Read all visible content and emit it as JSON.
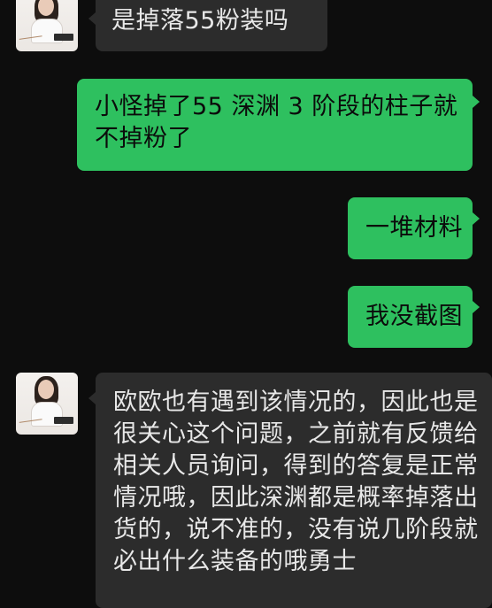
{
  "messages": [
    {
      "side": "in",
      "text": "是掉落55粉装吗"
    },
    {
      "side": "out",
      "text": "小怪掉了55 深渊 3 阶段的柱子就不掉粉了"
    },
    {
      "side": "out",
      "text": "一堆材料"
    },
    {
      "side": "out",
      "text": "我没截图"
    },
    {
      "side": "in",
      "text": "欧欧也有遇到该情况的，因此也是很关心这个问题，之前就有反馈给相关人员询问，得到的答复是正常情况哦，因此深渊都是概率掉落出货的，说不准的，没有说几阶段就必出什么装备的哦勇士"
    }
  ],
  "colors": {
    "background": "#0d0d0d",
    "incoming_bubble": "#2c2c2c",
    "outgoing_bubble": "#2ec05f",
    "incoming_text": "#e8e8e8",
    "outgoing_text": "#0b0b0b"
  },
  "icons": {
    "contact_avatar": "contact-avatar"
  }
}
